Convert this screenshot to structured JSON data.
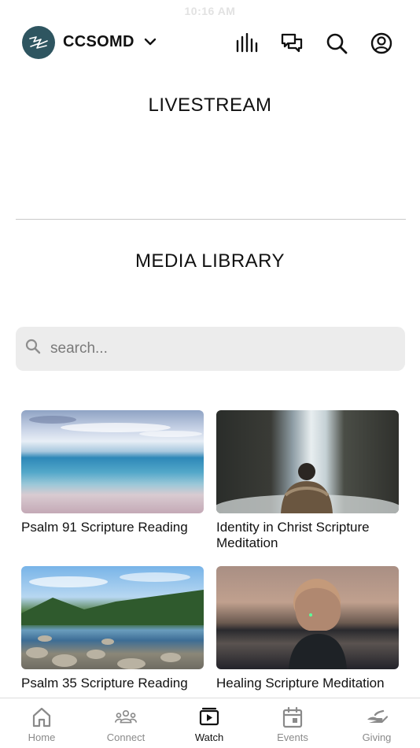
{
  "status_bar": {
    "time": "10:16 AM"
  },
  "header": {
    "church_name": "CCSOMD",
    "icons": [
      "audio-bars-icon",
      "chat-icon",
      "search-icon",
      "account-icon"
    ]
  },
  "livestream": {
    "title": "LIVESTREAM"
  },
  "media_library": {
    "title": "MEDIA LIBRARY",
    "search": {
      "placeholder": "search...",
      "value": ""
    },
    "items": [
      {
        "title": "Psalm 91 Scripture Reading",
        "thumbnail": "calm sea and sky"
      },
      {
        "title": "Identity in Christ Scripture Meditation",
        "thumbnail": "person before waterfall"
      },
      {
        "title": "Psalm 35 Scripture Reading",
        "thumbnail": "rocky lake with forest"
      },
      {
        "title": "Healing Scripture Meditation",
        "thumbnail": "woman at sunset lake"
      }
    ]
  },
  "bottom_nav": {
    "active": "Watch",
    "items": [
      {
        "label": "Home",
        "icon": "home-icon"
      },
      {
        "label": "Connect",
        "icon": "people-icon"
      },
      {
        "label": "Watch",
        "icon": "play-icon"
      },
      {
        "label": "Events",
        "icon": "calendar-icon"
      },
      {
        "label": "Giving",
        "icon": "giving-hand-icon"
      }
    ]
  },
  "colors": {
    "logo_bg": "#2e5560",
    "active_nav": "#111111",
    "inactive_nav": "#8a8a8a",
    "search_bg": "#ececec"
  }
}
